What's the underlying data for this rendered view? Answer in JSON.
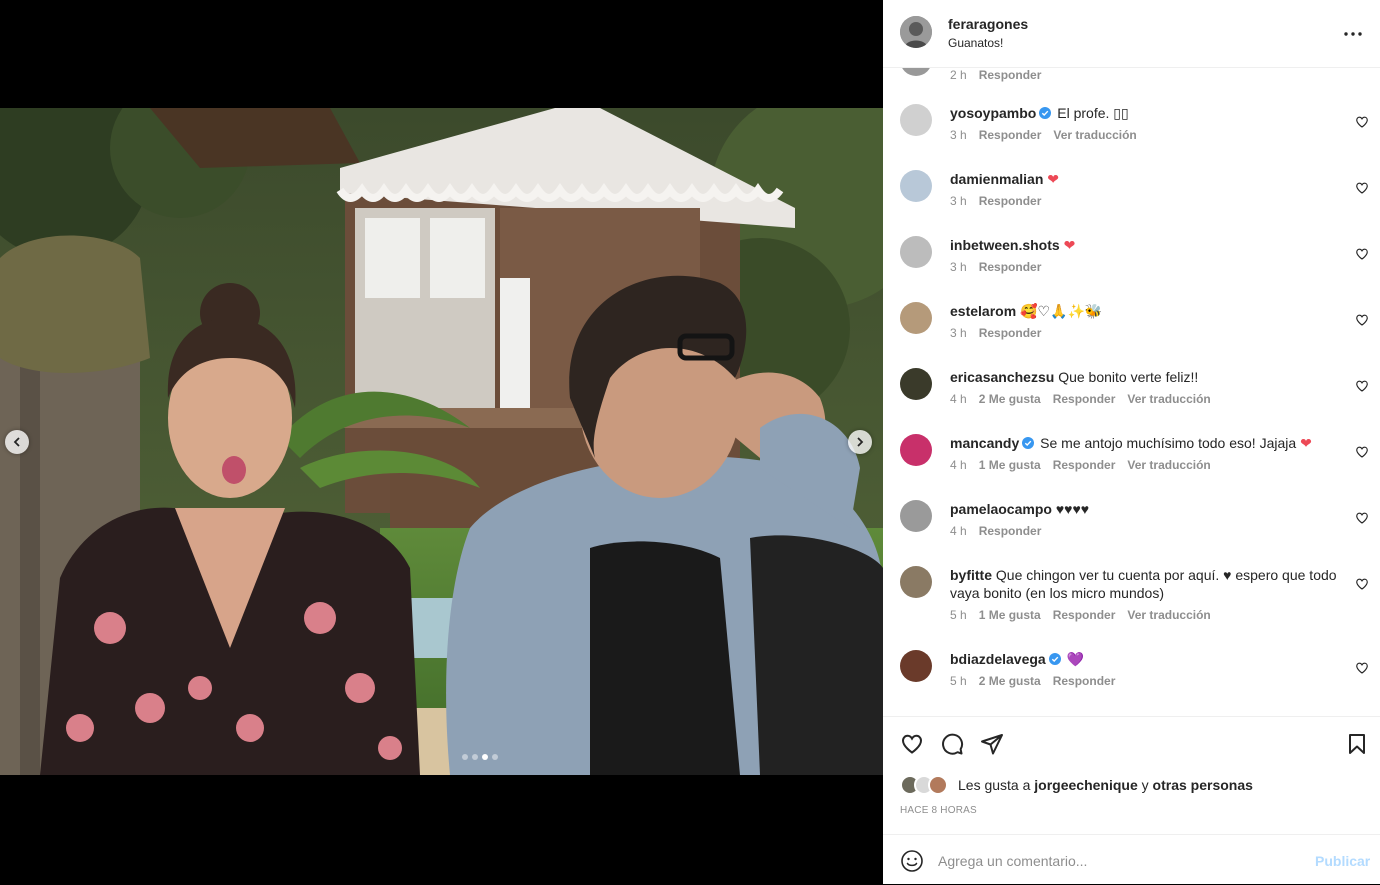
{
  "post": {
    "owner": {
      "username": "feraragones",
      "caption": "Guanatos!"
    },
    "carousel": {
      "slide_count": 4,
      "active_slide": 3
    }
  },
  "partial_comment": {
    "time": "2 h",
    "reply": "Responder"
  },
  "comments": [
    {
      "user": "yosoypambo",
      "verified": true,
      "text": "El profe. ▯▯",
      "time": "3 h",
      "likes": "",
      "reply": "Responder",
      "translate": "Ver traducción"
    },
    {
      "user": "damienmalian",
      "verified": false,
      "text": "❤",
      "time": "3 h",
      "likes": "",
      "reply": "Responder",
      "translate": ""
    },
    {
      "user": "inbetween.shots",
      "verified": false,
      "text": "❤",
      "time": "3 h",
      "likes": "",
      "reply": "Responder",
      "translate": ""
    },
    {
      "user": "estelarom",
      "verified": false,
      "text": "🥰♡🙏✨🐝",
      "time": "3 h",
      "likes": "",
      "reply": "Responder",
      "translate": ""
    },
    {
      "user": "ericasanchezsu",
      "verified": false,
      "text": "Que bonito verte feliz!!",
      "time": "4 h",
      "likes": "2 Me gusta",
      "reply": "Responder",
      "translate": "Ver traducción"
    },
    {
      "user": "mancandy",
      "verified": true,
      "text": "Se me antojo muchísimo todo eso! Jajaja ❤",
      "time": "4 h",
      "likes": "1 Me gusta",
      "reply": "Responder",
      "translate": "Ver traducción"
    },
    {
      "user": "pamelaocampo",
      "verified": false,
      "text": "♥♥♥♥",
      "time": "4 h",
      "likes": "",
      "reply": "Responder",
      "translate": ""
    },
    {
      "user": "byfitte",
      "verified": false,
      "text": "Que chingon ver tu cuenta por aquí. ♥ espero que todo vaya bonito (en los micro mundos)",
      "time": "5 h",
      "likes": "1 Me gusta",
      "reply": "Responder",
      "translate": "Ver traducción"
    },
    {
      "user": "bdiazdelavega",
      "verified": true,
      "text": "💜",
      "time": "5 h",
      "likes": "2 Me gusta",
      "reply": "Responder",
      "translate": ""
    }
  ],
  "likes": {
    "prefix": "Les gusta a ",
    "user": "jorgeechenique",
    "middle": " y ",
    "others": "otras personas"
  },
  "timestamp": "HACE 8 HORAS",
  "add_comment": {
    "placeholder": "Agrega un comentario...",
    "publish": "Publicar"
  },
  "colors": {
    "accent_blue": "#0095f6",
    "publish_disabled": "#b3dbff",
    "verified_blue": "#3897f0",
    "heart_red": "#ed4956",
    "muted": "#8e8e8e"
  },
  "icons": [
    "chevron-left-icon",
    "chevron-right-icon",
    "more-icon",
    "heart-icon",
    "comment-icon",
    "share-icon",
    "bookmark-icon",
    "smile-icon",
    "verified-icon"
  ]
}
